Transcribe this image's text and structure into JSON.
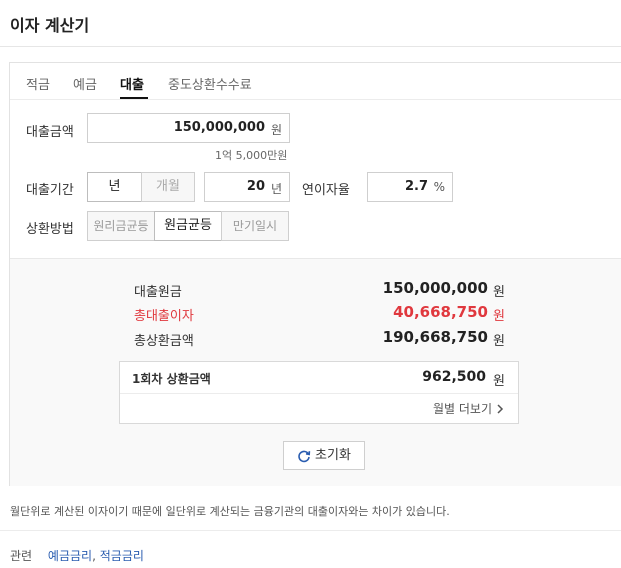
{
  "header": {
    "title": "이자 계산기"
  },
  "tabs": [
    {
      "label": "적금",
      "active": false
    },
    {
      "label": "예금",
      "active": false
    },
    {
      "label": "대출",
      "active": true
    },
    {
      "label": "중도상환수수료",
      "active": false
    }
  ],
  "form": {
    "amount_label": "대출금액",
    "amount_value": "150,000,000",
    "amount_unit": "원",
    "amount_hint": "1억 5,000만원",
    "period_label": "대출기간",
    "period_unit_year": "년",
    "period_unit_month": "개월",
    "period_unit_selected": "년",
    "period_value": "20",
    "period_value_unit": "년",
    "rate_label": "연이자율",
    "rate_value": "2.7",
    "rate_unit": "%",
    "method_label": "상환방법",
    "methods": [
      "원리금균등",
      "원금균등",
      "만기일시"
    ],
    "method_selected": "원금균등"
  },
  "result": {
    "principal_label": "대출원금",
    "principal_value": "150,000,000",
    "interest_label": "총대출이자",
    "interest_value": "40,668,750",
    "total_label": "총상환금액",
    "total_value": "190,668,750",
    "unit": "원",
    "first_label": "1회차 상환금액",
    "first_value": "962,500",
    "monthly_more": "월별 더보기",
    "reset_label": "초기화"
  },
  "note": "월단위로 계산된 이자이기 때문에 일단위로 계산되는 금융기관의 대출이자와는 차이가 있습니다.",
  "related": {
    "label": "관련",
    "links": [
      "예금금리",
      "적금금리"
    ],
    "separator": ","
  },
  "colors": {
    "accent_red": "#e0383e",
    "link_blue": "#2a5db0"
  }
}
